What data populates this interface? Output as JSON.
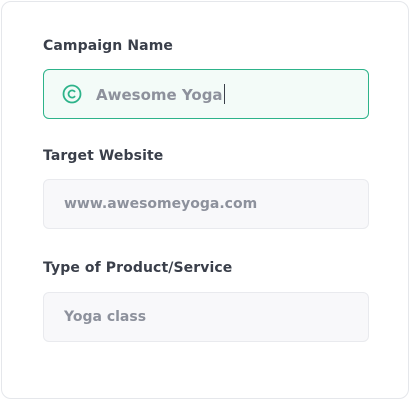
{
  "form": {
    "campaign_name": {
      "label": "Campaign Name",
      "value": "Awesome Yoga",
      "icon": "copyright-icon",
      "state": "focused"
    },
    "target_website": {
      "label": "Target Website",
      "value": "www.awesomeyoga.com"
    },
    "product_type": {
      "label": "Type of Product/Service",
      "value": "Yoga class"
    }
  },
  "colors": {
    "accent": "#2db38a",
    "label_text": "#3a3f4a",
    "value_text": "#8d919c",
    "field_bg": "#f8f8fa",
    "field_border": "#e9eaee"
  }
}
